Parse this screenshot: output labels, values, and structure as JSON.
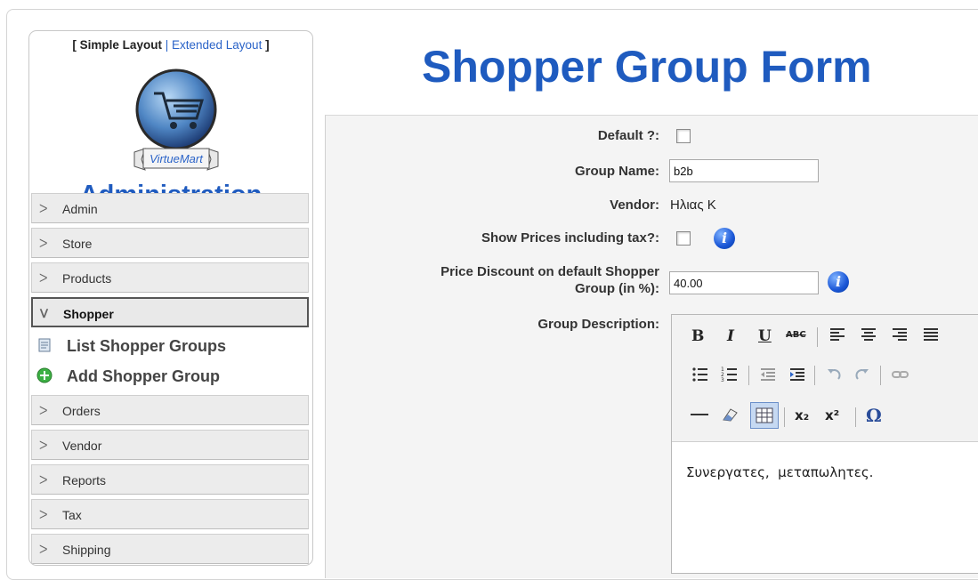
{
  "sidebar": {
    "layout_simple": "Simple Layout",
    "layout_separator": "|",
    "layout_extended": "Extended Layout",
    "bracket_open": "[",
    "bracket_close": "]",
    "logo_text": "VirtueMart",
    "admin_title": "Administration",
    "menu": [
      {
        "label": "Admin",
        "expanded": false
      },
      {
        "label": "Store",
        "expanded": false
      },
      {
        "label": "Products",
        "expanded": false
      },
      {
        "label": "Shopper",
        "expanded": true
      },
      {
        "label": "Orders",
        "expanded": false
      },
      {
        "label": "Vendor",
        "expanded": false
      },
      {
        "label": "Reports",
        "expanded": false
      },
      {
        "label": "Tax",
        "expanded": false
      },
      {
        "label": "Shipping",
        "expanded": false
      }
    ],
    "shopper_sub": [
      {
        "label": "List Shopper Groups",
        "icon": "list-icon"
      },
      {
        "label": "Add Shopper Group",
        "icon": "add-icon"
      }
    ]
  },
  "page": {
    "title": "Shopper Group Form"
  },
  "form": {
    "default_label": "Default ?:",
    "default_checked": false,
    "group_name_label": "Group Name:",
    "group_name_value": "b2b",
    "vendor_label": "Vendor:",
    "vendor_value": "Ηλιας Κ",
    "show_prices_label": "Show Prices including tax?:",
    "show_prices_checked": false,
    "discount_label_line1": "Price Discount on default Shopper",
    "discount_label_line2": "Group (in %):",
    "discount_value": "40.00",
    "description_label": "Group Description:",
    "description_text": "Συνεργατες,  μεταπωλητες."
  },
  "editor_toolbar": {
    "bold": "B",
    "italic": "I",
    "underline": "U",
    "strike": "ABC",
    "subscript": "x₂",
    "superscript": "x²",
    "special_char": "Ω"
  },
  "colors": {
    "title_blue": "#1f5bbf",
    "link_blue": "#2a63c8",
    "info_blue": "#1a56d6"
  }
}
